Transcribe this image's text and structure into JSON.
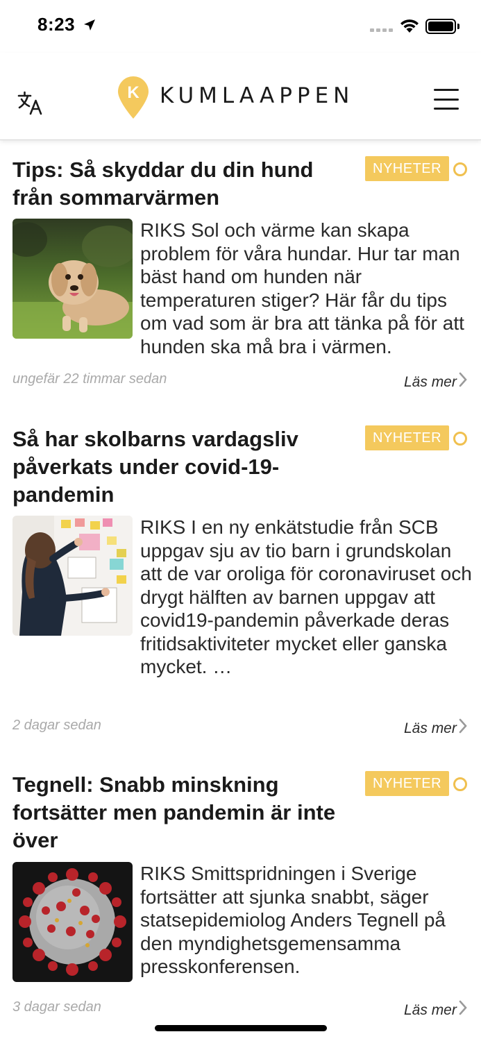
{
  "status_bar": {
    "time": "8:23"
  },
  "header": {
    "logo_letter": "K",
    "logo_text": "KUMLAAPPEN",
    "brand_color": "#F4C95D"
  },
  "articles": [
    {
      "title": "Tips: Så skyddar du din hund från sommarvärmen",
      "tag": "NYHETER",
      "excerpt": "RIKS Sol och värme kan skapa problem för våra hundar. Hur tar man bäst hand om hunden när temperaturen stiger? Här får du tips om vad som är bra att tänka på för att hunden ska må bra i värmen.",
      "time_ago": "ungefär 22 timmar sedan",
      "read_more": "Läs mer",
      "image": "dog-photo"
    },
    {
      "title": "Så har skolbarns vardagsliv påverkats under covid-19-pandemin",
      "tag": "NYHETER",
      "excerpt": "RIKS I en ny enkätstudie från SCB uppgav sju av tio barn i grundskolan  att de var oroliga för coronaviruset och drygt hälften av barnen uppgav att covid19-pandemin påverkade deras fritidsaktiviteter mycket eller ganska mycket. …",
      "time_ago": "2 dagar sedan",
      "read_more": "Läs mer",
      "image": "whiteboard-photo"
    },
    {
      "title": "Tegnell: Snabb minskning fortsätter men pandemin är inte över",
      "tag": "NYHETER",
      "excerpt": "RIKS Smittspridningen i Sverige fortsätter att sjunka snabbt, säger statsepidemiolog Anders Tegnell på den myndighetsgemensamma presskonferensen.",
      "time_ago": "3 dagar sedan",
      "read_more": "Läs mer",
      "image": "coronavirus-illustration"
    }
  ]
}
